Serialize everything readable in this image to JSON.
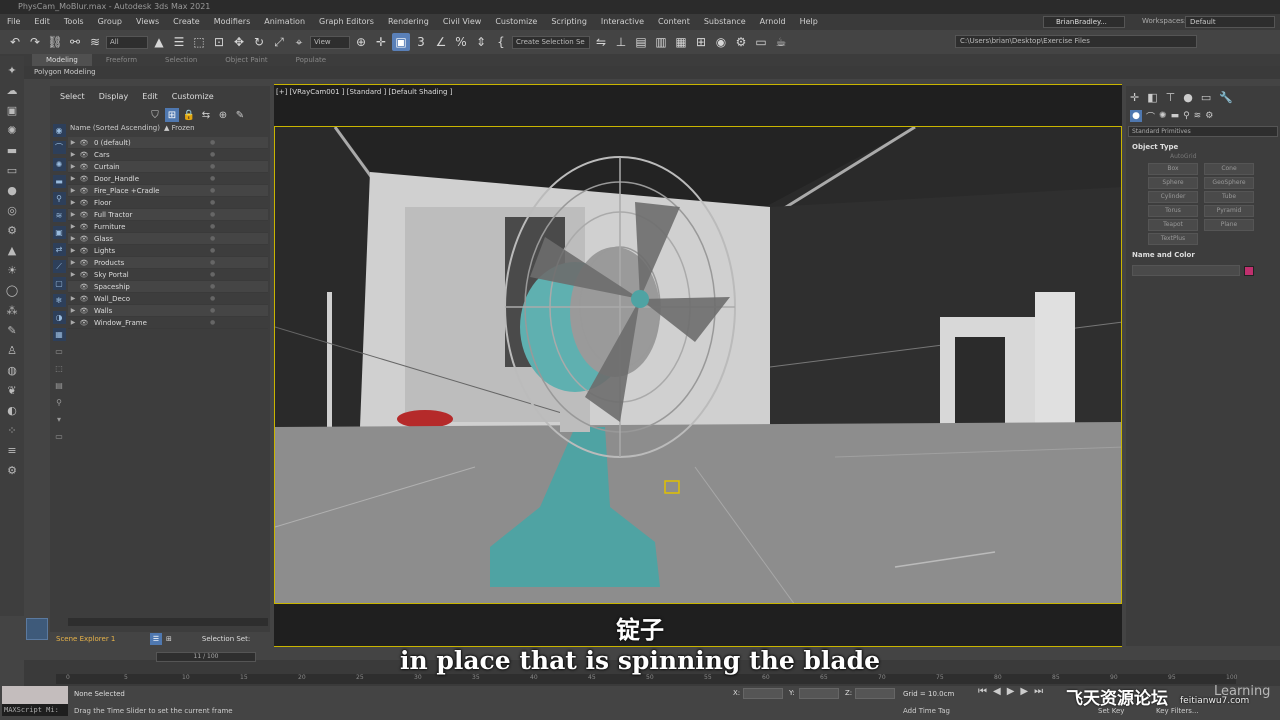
{
  "window": {
    "title": "PhysCam_MoBlur.max - Autodesk 3ds Max 2021"
  },
  "menu": [
    "File",
    "Edit",
    "Tools",
    "Group",
    "Views",
    "Create",
    "Modifiers",
    "Animation",
    "Graph Editors",
    "Rendering",
    "Civil View",
    "Customize",
    "Scripting",
    "Interactive",
    "Content",
    "Substance",
    "Arnold",
    "Help"
  ],
  "user": {
    "name": "BrianBradley...",
    "workspace_label": "Workspaces:",
    "workspace_value": "Default"
  },
  "toolbar": {
    "filter": "All",
    "view_dropdown": "View",
    "create_selection": "Create Selection Se",
    "path": "C:\\Users\\brian\\Desktop\\Exercise Files"
  },
  "ribbon": {
    "tabs": [
      "Modeling",
      "Freeform",
      "Selection",
      "Object Paint",
      "Populate"
    ],
    "active": "Modeling",
    "subtab": "Polygon Modeling"
  },
  "scene_explorer": {
    "menu": [
      "Select",
      "Display",
      "Edit",
      "Customize"
    ],
    "col_name": "Name (Sorted Ascending)",
    "col_frozen": "▲ Frozen",
    "rows": [
      "0 (default)",
      "Cars",
      "Curtain",
      "Door_Handle",
      "Fire_Place +Cradle",
      "Floor",
      "Full Tractor",
      "Furniture",
      "Glass",
      "Lights",
      "Products",
      "Sky Portal",
      "Spaceship",
      "Wall_Deco",
      "Walls",
      "Window_Frame"
    ],
    "footer_name": "Scene Explorer 1",
    "footer_set": "Selection Set:"
  },
  "viewport": {
    "label": "[+] [VRayCam001 ] [Standard ] [Default Shading ]"
  },
  "command_panel": {
    "category": "Standard Primitives",
    "object_type_title": "Object Type",
    "autogrid": "AutoGrid",
    "buttons": [
      "Box",
      "Cone",
      "Sphere",
      "GeoSphere",
      "Cylinder",
      "Tube",
      "Torus",
      "Pyramid",
      "Teapot",
      "Plane",
      "TextPlus"
    ],
    "name_color_title": "Name and Color",
    "swatch_color": "#c0306e"
  },
  "timeline": {
    "slider": "11 / 100",
    "ticks": [
      "0",
      "5",
      "10",
      "15",
      "20",
      "25",
      "30",
      "35",
      "40",
      "45",
      "50",
      "55",
      "60",
      "65",
      "70",
      "75",
      "80",
      "85",
      "90",
      "95",
      "100"
    ]
  },
  "status": {
    "maxscript": "MAXScript Mi:",
    "selection": "None Selected",
    "hint": "Drag the Time Slider to set the current frame",
    "x_label": "X:",
    "y_label": "Y:",
    "z_label": "Z:",
    "grid": "Grid = 10.0cm",
    "add_time_tag": "Add Time Tag",
    "set_key": "Set Key",
    "key_filters": "Key Filters..."
  },
  "subtitles": {
    "chinese": "锭子",
    "english": "in place that is spinning the blade"
  },
  "watermark": {
    "cn": "飞天资源论坛",
    "url": "feitianwu7.com",
    "brand": "Learning"
  }
}
